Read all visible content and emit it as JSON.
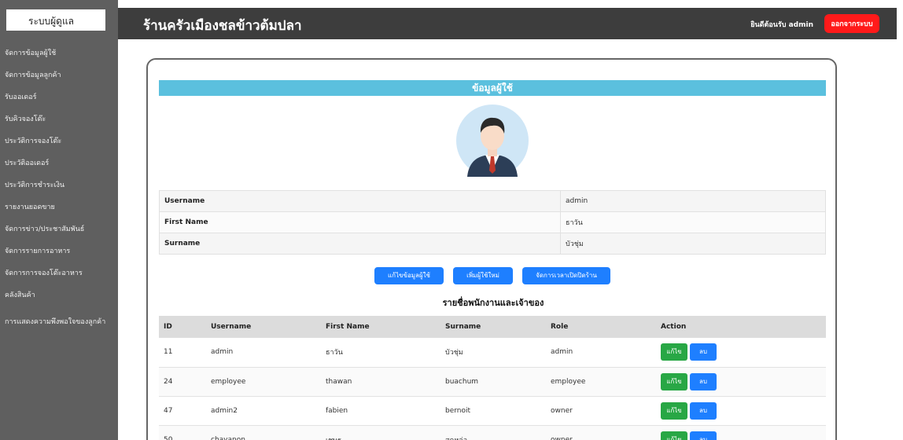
{
  "sidebar": {
    "brand": "ระบบผู้ดูแล",
    "items": [
      {
        "label": "จัดการข้อมูลผู้ใช้"
      },
      {
        "label": "จัดการข้อมูลลูกค้า"
      },
      {
        "label": "รับออเดอร์"
      },
      {
        "label": "รับคิวจองโต๊ะ"
      },
      {
        "label": "ประวัติการจองโต๊ะ"
      },
      {
        "label": "ประวัติออเดอร์"
      },
      {
        "label": "ประวัติการชำระเงิน"
      },
      {
        "label": "รายงานยอดขาย"
      },
      {
        "label": "จัดการข่าว/ประชาสัมพันธ์"
      },
      {
        "label": "จัดการรายการอาหาร"
      },
      {
        "label": "จัดการการจองโต๊ะอาหาร"
      },
      {
        "label": "คลังสินค้า"
      },
      {
        "label": "การแสดงความพึงพอใจของลูกค้า"
      }
    ]
  },
  "header": {
    "title": "ร้านครัวเมืองชลข้าวต้มปลา",
    "welcome": "ยินดีต้อนรับ admin",
    "logout_label": "ออกจากระบบ"
  },
  "profile": {
    "section_title": "ข้อมูลผู้ใช้",
    "fields": [
      {
        "label": "Username",
        "value": "admin"
      },
      {
        "label": "First Name",
        "value": "ธาวัน"
      },
      {
        "label": "Surname",
        "value": "บัวชุ่ม"
      }
    ],
    "buttons": {
      "edit_profile": "แก้ไขข้อมูลผู้ใช้",
      "add_user": "เพิ่มผู้ใช้ใหม่",
      "manage_hours": "จัดการเวลาเปิดปิดร้าน"
    }
  },
  "users_table": {
    "title": "รายชื่อพนักงานและเจ้าของ",
    "headers": [
      "ID",
      "Username",
      "First Name",
      "Surname",
      "Role",
      "Action"
    ],
    "edit_label": "แก้ไข",
    "delete_label": "ลบ",
    "rows": [
      {
        "id": "11",
        "username": "admin",
        "first_name": "ธาวัน",
        "surname": "บัวชุ่ม",
        "role": "admin"
      },
      {
        "id": "24",
        "username": "employee",
        "first_name": "thawan",
        "surname": "buachum",
        "role": "employee"
      },
      {
        "id": "47",
        "username": "admin2",
        "first_name": "fabien",
        "surname": "bernoit",
        "role": "owner"
      },
      {
        "id": "50",
        "username": "chayanon",
        "first_name": "เชษฐ",
        "surname": "สุดหล่อ",
        "role": "owner"
      }
    ]
  },
  "colors": {
    "sidebar": "#5f5f5f",
    "header": "#3d3d3d",
    "section_title": "#5bc0de",
    "primary_button": "#1e7fff",
    "edit_button": "#28a745",
    "logout_button": "#ff1a1a"
  },
  "icons": {
    "avatar": "businessman-avatar-icon"
  }
}
